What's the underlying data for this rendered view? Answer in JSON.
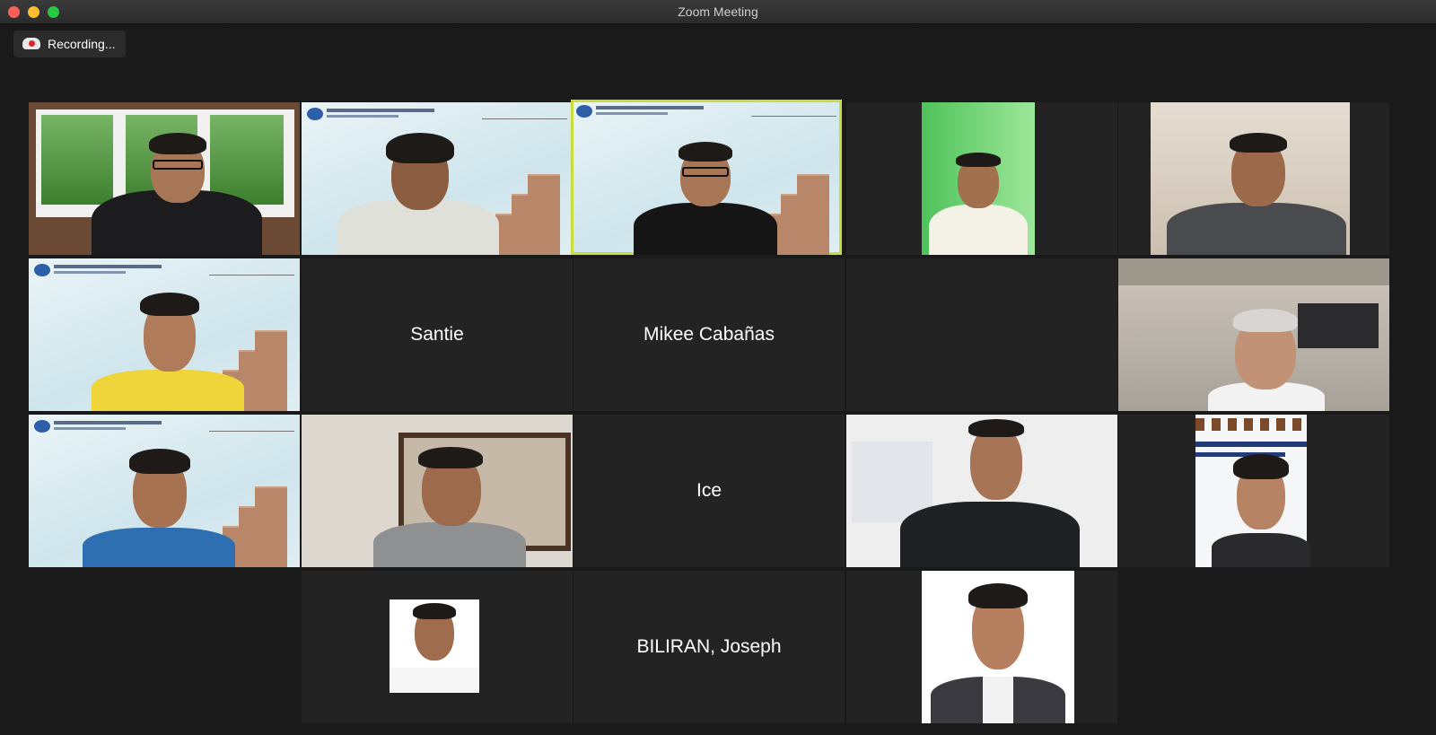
{
  "window": {
    "title": "Zoom Meeting"
  },
  "recording": {
    "label": "Recording..."
  },
  "participants": {
    "santie": "Santie",
    "mikee": "Mikee Cabañas",
    "ice": "Ice",
    "joseph": "BILIRAN, Joseph"
  },
  "colors": {
    "active_speaker_border": "#c8dc3a",
    "tile_bg": "#232323",
    "record_dot": "#e02424"
  },
  "icons": [
    "close-icon",
    "minimize-icon",
    "maximize-icon",
    "record-cloud-icon"
  ]
}
